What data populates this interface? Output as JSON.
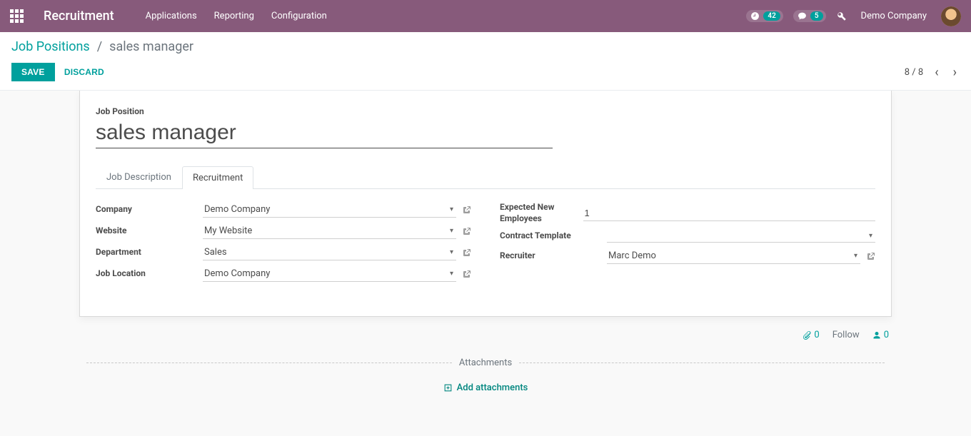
{
  "nav": {
    "brand": "Recruitment",
    "menu": [
      "Applications",
      "Reporting",
      "Configuration"
    ],
    "activityCount": "42",
    "messageCount": "5",
    "company": "Demo Company"
  },
  "breadcrumb": {
    "root": "Job Positions",
    "sep": "/",
    "current": "sales manager"
  },
  "buttons": {
    "save": "SAVE",
    "discard": "DISCARD"
  },
  "pager": {
    "text": "8 / 8"
  },
  "form": {
    "titleLabel": "Job Position",
    "titleValue": "sales manager",
    "tabs": {
      "jobDesc": "Job Description",
      "recruitment": "Recruitment"
    },
    "left": {
      "company": {
        "label": "Company",
        "value": "Demo Company"
      },
      "website": {
        "label": "Website",
        "value": "My Website"
      },
      "department": {
        "label": "Department",
        "value": "Sales"
      },
      "location": {
        "label": "Job Location",
        "value": "Demo Company"
      }
    },
    "right": {
      "expected": {
        "label": "Expected New Employees",
        "value": "1"
      },
      "contract": {
        "label": "Contract Template",
        "value": ""
      },
      "recruiter": {
        "label": "Recruiter",
        "value": "Marc Demo"
      }
    }
  },
  "chatter": {
    "attachCount": "0",
    "follow": "Follow",
    "followerCount": "0",
    "attachmentsHeader": "Attachments",
    "addAttachments": "Add attachments"
  }
}
